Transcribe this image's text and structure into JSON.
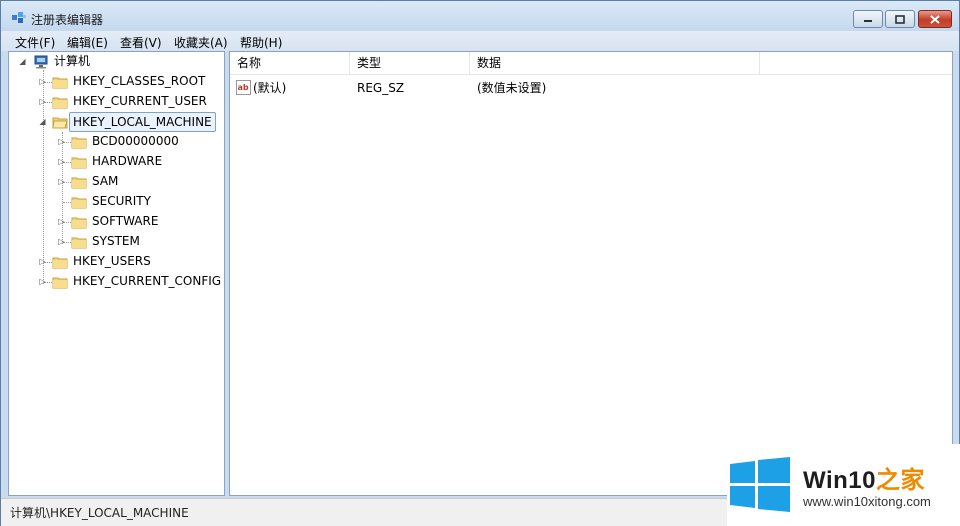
{
  "window": {
    "title": "注册表编辑器"
  },
  "menu": [
    "文件(F)",
    "编辑(E)",
    "查看(V)",
    "收藏夹(A)",
    "帮助(H)"
  ],
  "tree": {
    "root": "计算机",
    "hives": [
      {
        "label": "HKEY_CLASSES_ROOT",
        "expanded": false
      },
      {
        "label": "HKEY_CURRENT_USER",
        "expanded": false
      },
      {
        "label": "HKEY_LOCAL_MACHINE",
        "expanded": true,
        "selected": true,
        "children": [
          "BCD00000000",
          "HARDWARE",
          "SAM",
          "SECURITY",
          "SOFTWARE",
          "SYSTEM"
        ]
      },
      {
        "label": "HKEY_USERS",
        "expanded": false
      },
      {
        "label": "HKEY_CURRENT_CONFIG",
        "expanded": false
      }
    ]
  },
  "values_table": {
    "columns": [
      "名称",
      "类型",
      "数据"
    ],
    "rows": [
      {
        "name": "(默认)",
        "type": "REG_SZ",
        "data": "(数值未设置)",
        "icon": "string-value-icon"
      }
    ]
  },
  "status": {
    "path": "计算机\\HKEY_LOCAL_MACHINE"
  },
  "watermark": {
    "brand_main": "Win10",
    "brand_suffix": "之家",
    "url": "www.win10xitong.com"
  },
  "colors": {
    "selection_border": "#7da2ce",
    "selection_bg": "#eaf3fd",
    "brand_blue": "#1ea0e6",
    "brand_orange": "#ef8a00"
  }
}
